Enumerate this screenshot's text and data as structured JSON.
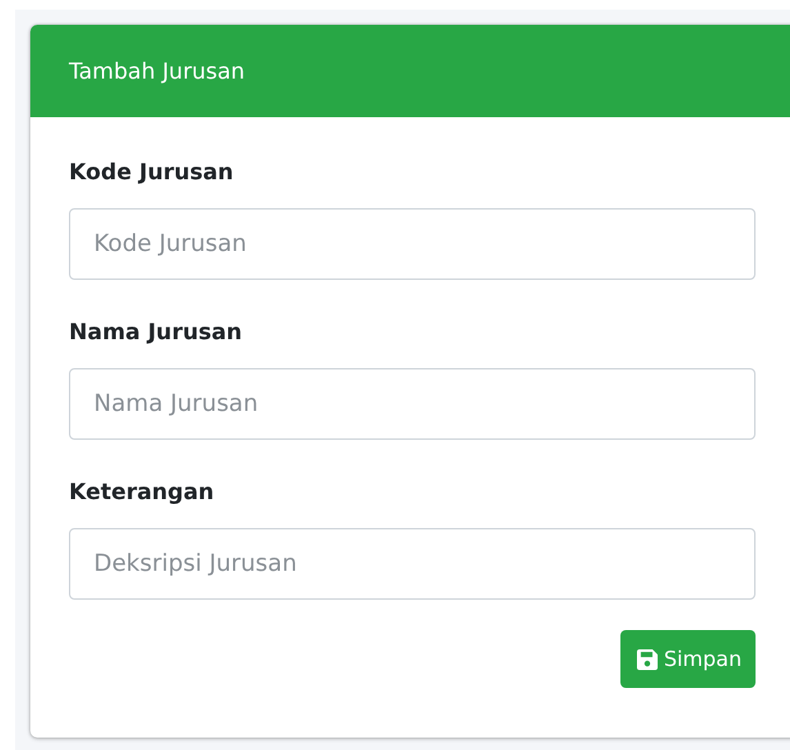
{
  "card": {
    "title": "Tambah Jurusan"
  },
  "fields": [
    {
      "label": "Kode Jurusan",
      "placeholder": "Kode Jurusan"
    },
    {
      "label": "Nama Jurusan",
      "placeholder": "Nama Jurusan"
    },
    {
      "label": "Keterangan",
      "placeholder": "Deksripsi Jurusan"
    }
  ],
  "buttons": [
    {
      "label": "Simpan"
    }
  ]
}
